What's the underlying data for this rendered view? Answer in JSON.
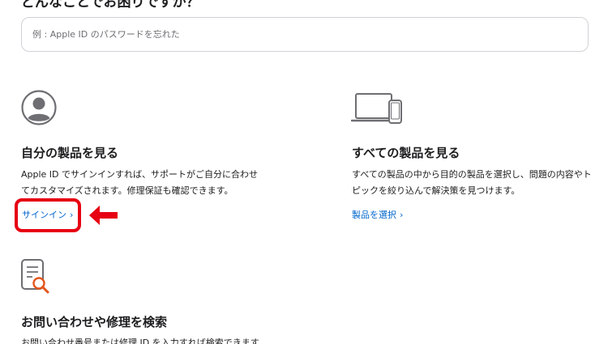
{
  "top_heading": "どんなことでお困りですか？",
  "search": {
    "placeholder": "例 : Apple ID のパスワードを忘れた"
  },
  "cards": {
    "my_products": {
      "icon": "person-icon",
      "title": "自分の製品を見る",
      "desc_line1": "Apple ID でサインインすれば、サポートがご自分に合わせ",
      "desc_line2": "てカスタマイズされます。修理保証も確認できます。",
      "link": "サインイン",
      "link_chevron": "›"
    },
    "all_products": {
      "icon": "laptop-phone-icon",
      "title": "すべての製品を見る",
      "desc_line1": "すべての製品の中から目的の製品を選択し、問題の内容やト",
      "desc_line2": "ピックを絞り込んで解決策を見つけます。",
      "link": "製品を選択",
      "link_chevron": "›"
    },
    "repair_search": {
      "icon": "document-search-icon",
      "title": "お問い合わせや修理を検索",
      "desc_line1": "お問い合わせ番号または修理 ID を入力すれば検索できます"
    }
  },
  "annotation": {
    "highlight_color": "#e60012",
    "arrow": "left-arrow-icon"
  },
  "colors": {
    "link": "#0066cc",
    "text": "#1d1d1f",
    "icon_gray": "#6e6e73",
    "search_accent": "#e3551c"
  }
}
